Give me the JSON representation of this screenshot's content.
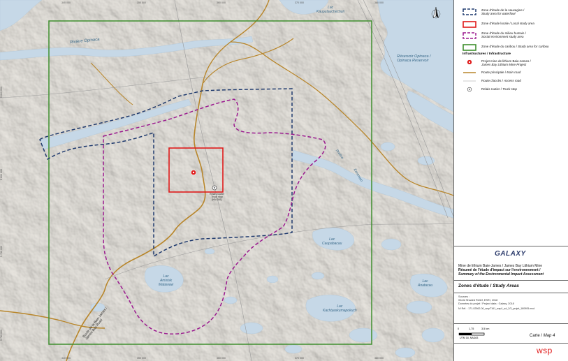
{
  "map": {
    "x_ticks": [
      "340 000",
      "350 000",
      "360 000",
      "370 000",
      "380 000"
    ],
    "y_ticks": [
      "5 810 000",
      "5 800 000",
      "5 790 000",
      "5 780 000"
    ],
    "labels": {
      "lac_kauputauchechun": [
        "Lac",
        "Kauputauchechun"
      ],
      "riviere_opinaca": "Rivière Opinaca",
      "reservoir_opinaca": [
        "Réservoir Opinaca /",
        "Opinaca Reservoir"
      ],
      "riviere_eastmain": [
        "Rivière",
        "Eastmain"
      ],
      "relais_routier": [
        "Relais routier",
        "Truck stop",
        "(KM 381)"
      ],
      "lac_caupabacau": [
        "Lac",
        "Caupabacau"
      ],
      "lac_amisisk": [
        "Lac",
        "Amisisk",
        "Matawaw"
      ],
      "lac_kachiyaskumapokuch": [
        "Lac",
        "Kachiyaskumapokuch"
      ],
      "lac_anatacau": [
        "Lac",
        "Anatacau"
      ],
      "route_baie_james": [
        "Route de la Baie-James /",
        "James Bay Road"
      ]
    }
  },
  "legend": {
    "items": [
      {
        "fr": "Zone d'étude de la sauvagine /",
        "en": "Study area for waterfowl"
      },
      {
        "fr": "Zone d'étude locale /",
        "en": "Local study area"
      },
      {
        "fr": "Zone d'étude du milieu humain /",
        "en": "Social environment study area"
      },
      {
        "fr": "Zone d'étude  du caribou /",
        "en": "Study area for caribou"
      }
    ],
    "infra_title": "Infrastructures / Infrastructure",
    "infra": [
      {
        "fr": "Projet mine de lithium Baie-James /",
        "en": "James Bay Lithium Mine Project"
      },
      {
        "fr": "Route principale /",
        "en": "Main road"
      },
      {
        "fr": "Route d'accès /",
        "en": "Access road"
      },
      {
        "fr": "Relais routier /",
        "en": "Truck stop"
      }
    ]
  },
  "title_block": {
    "logo": "GALAXY",
    "line1": "Mine de lithium Baie-James / James Bay Lithium Mine",
    "line2": "Résumé de l'étude d'impact sur l'environnement /",
    "line3": "Summary of the Environmental Impact Assessment",
    "map_title_fr": "Zones d'étude",
    "map_title_en": "Study Areas",
    "sources_label": "Sources :",
    "source1": "World Shaded Relief, ESRI, 2018",
    "source2": "Données du projet / Project data :  Galaxy, 2018",
    "file": "N/ Réf. : 171-02562-00_wspT161_wsp1_sd_2/3_projet_180905.mxd",
    "scale_labels": [
      "0",
      "1,75",
      "3,5 km"
    ],
    "projection": "UTM 18, NAD83",
    "map_label_fr": "Carte /",
    "map_label_en": "Map 4",
    "brand": "wsp"
  },
  "colors": {
    "waterfowl": "#1f3a6e",
    "local": "#e01b1b",
    "social": "#9b1a8f",
    "caribou": "#3f8f2e",
    "main_road": "#b8862b",
    "water": "#c5d7e6",
    "land": "#e8e5df"
  }
}
